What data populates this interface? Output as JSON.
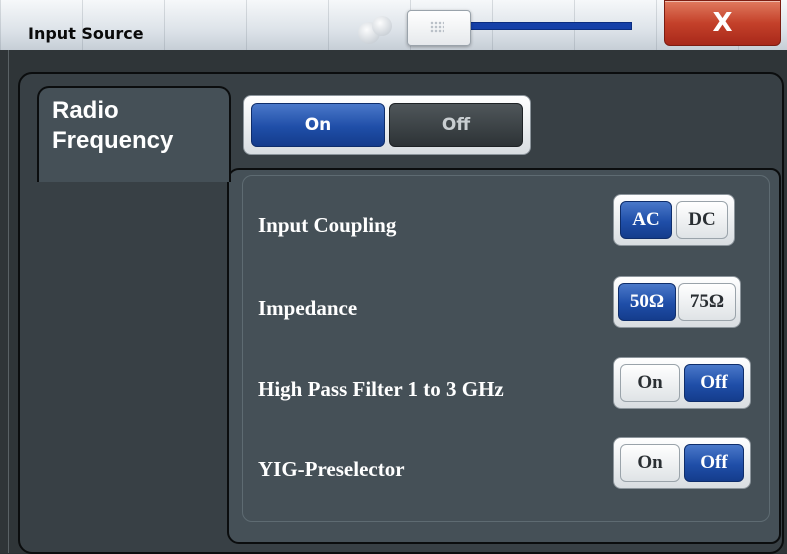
{
  "window": {
    "title": "Input Source",
    "close_label": "X"
  },
  "tab": {
    "label": "Radio\nFrequency"
  },
  "radio_frequency": {
    "on_label": "On",
    "off_label": "Off",
    "selected": "On"
  },
  "settings": [
    {
      "label": "Input Coupling",
      "options": [
        "AC",
        "DC"
      ],
      "selected": "AC"
    },
    {
      "label": "Impedance",
      "options": [
        "50Ω",
        "75Ω"
      ],
      "selected": "50Ω"
    },
    {
      "label": "High Pass Filter 1 to 3 GHz",
      "options": [
        "On",
        "Off"
      ],
      "selected": "Off"
    },
    {
      "label": "YIG-Preselector",
      "options": [
        "On",
        "Off"
      ],
      "selected": "Off"
    }
  ],
  "colors": {
    "selected_blue": "#1f4ea8",
    "close_red": "#c4412a",
    "panel_bg": "#455057"
  }
}
